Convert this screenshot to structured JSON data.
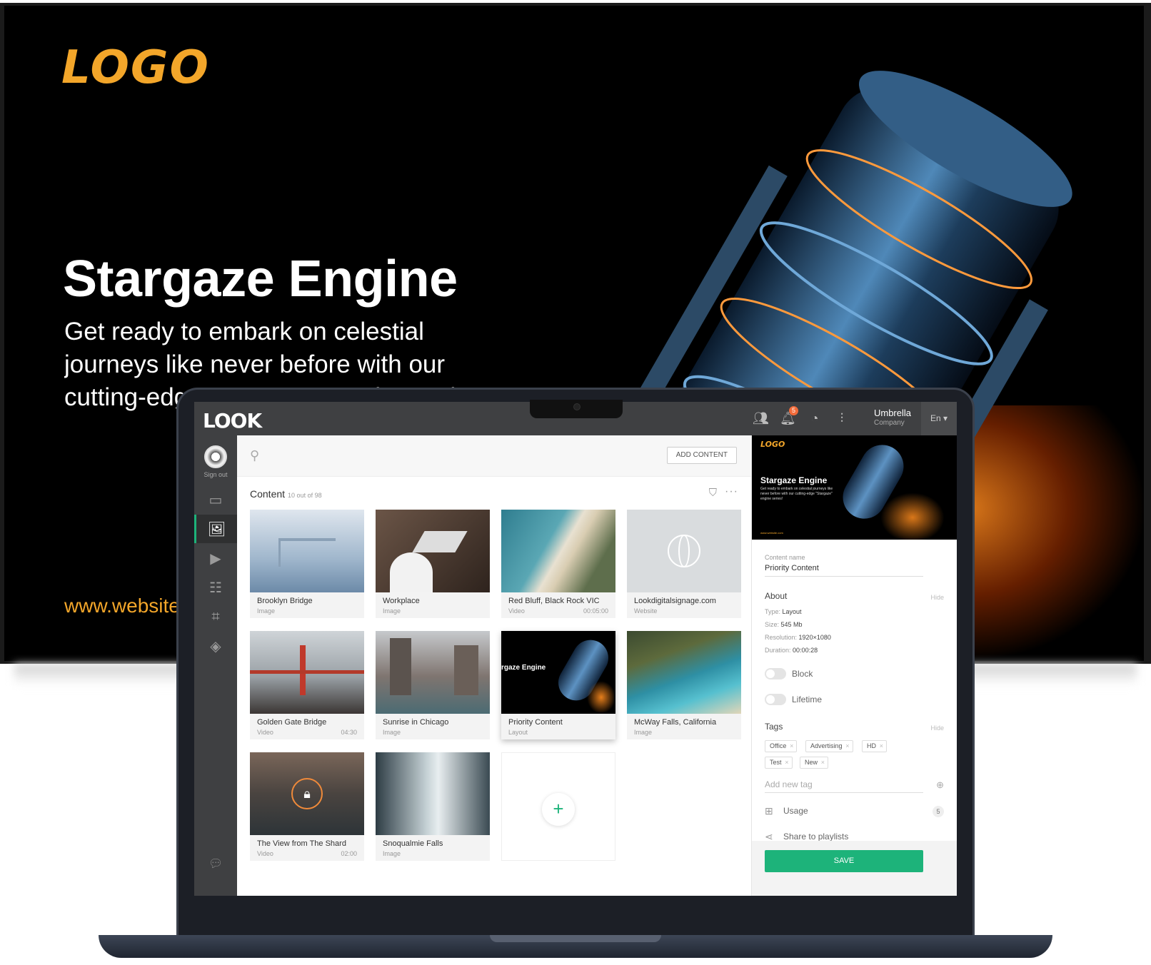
{
  "tv": {
    "logo": "LOGO",
    "title": "Stargaze Engine",
    "subtitle": "Get ready to embark on celestial journeys like never before with our cutting-edge \"Stargaze\" engine series!",
    "url": "www.website.com"
  },
  "app": {
    "brand": "LOOK",
    "notifications_count": "5",
    "company_name": "Umbrella",
    "company_sub": "Company",
    "language": "En ▾"
  },
  "sidebar": {
    "sign_out": "Sign out"
  },
  "toolbar": {
    "add_content": "ADD CONTENT"
  },
  "content": {
    "heading": "Content",
    "count": "10 out of 98",
    "items": [
      {
        "name": "Brooklyn Bridge",
        "type": "Image",
        "duration": ""
      },
      {
        "name": "Workplace",
        "type": "Image",
        "duration": ""
      },
      {
        "name": "Red Bluff, Black Rock VIC",
        "type": "Video",
        "duration": "00:05:00"
      },
      {
        "name": "Lookdigitalsignage.com",
        "type": "Website",
        "duration": ""
      },
      {
        "name": "Golden Gate Bridge",
        "type": "Video",
        "duration": "04:30"
      },
      {
        "name": "Sunrise in Chicago",
        "type": "Image",
        "duration": ""
      },
      {
        "name": "Priority Content",
        "type": "Layout",
        "duration": ""
      },
      {
        "name": "McWay Falls, California",
        "type": "Image",
        "duration": ""
      },
      {
        "name": "The View from The Shard",
        "type": "Video",
        "duration": "02:00"
      },
      {
        "name": "Snoqualmie Falls",
        "type": "Image",
        "duration": ""
      }
    ]
  },
  "panel": {
    "preview_logo": "LOGO",
    "preview_title": "Stargaze Engine",
    "preview_sub": "Get ready to embark on celestial journeys like never before with our cutting-edge \"Stargaze\" engine series!",
    "preview_url": "www.website.com",
    "content_name_label": "Content name",
    "content_name_value": "Priority Content",
    "about_heading": "About",
    "hide_label": "Hide",
    "type_label": "Type:",
    "type_value": "Layout",
    "size_label": "Size:",
    "size_value": "545 Mb",
    "resolution_label": "Resolution:",
    "resolution_value": "1920×1080",
    "duration_label": "Duration:",
    "duration_value": "00:00:28",
    "block_label": "Block",
    "lifetime_label": "Lifetime",
    "tags_heading": "Tags",
    "tags": [
      "Office",
      "Advertising",
      "HD",
      "Test",
      "New"
    ],
    "add_tag_placeholder": "Add new tag",
    "usage_label": "Usage",
    "usage_count": "5",
    "share_label": "Share to playlists",
    "save_label": "SAVE"
  },
  "colors": {
    "accent": "#1db37a",
    "brand_orange": "#f3a62a",
    "topbar": "#3f4042"
  }
}
